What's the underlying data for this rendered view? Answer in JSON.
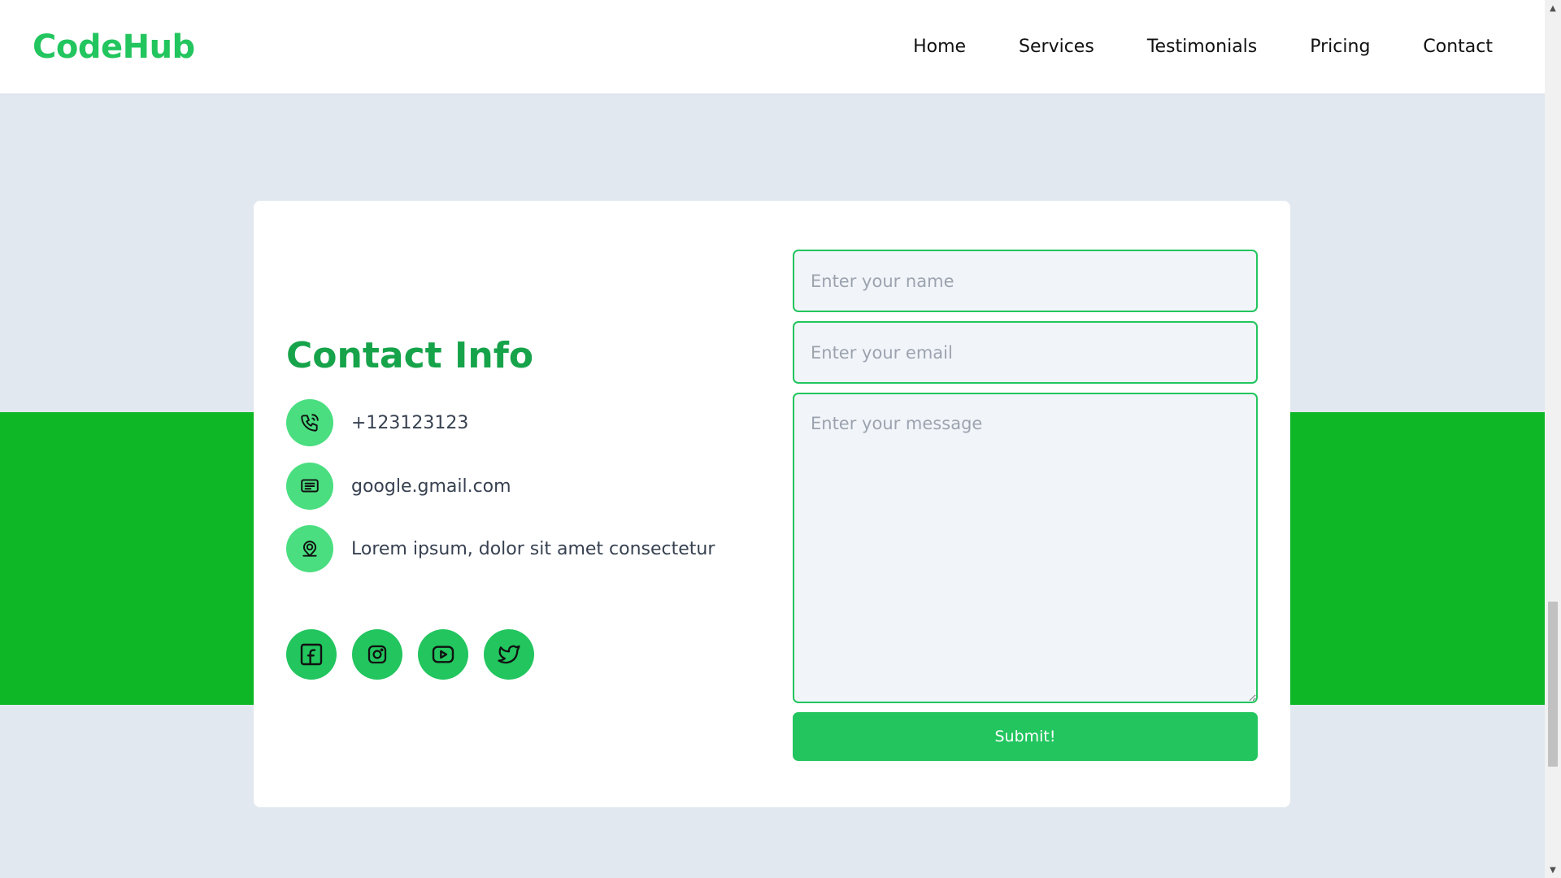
{
  "brand": {
    "name": "CodeHub",
    "color": "#22c55e"
  },
  "nav": {
    "items": [
      {
        "label": "Home"
      },
      {
        "label": "Services"
      },
      {
        "label": "Testimonials"
      },
      {
        "label": "Pricing"
      },
      {
        "label": "Contact"
      }
    ]
  },
  "contact": {
    "title": "Contact Info",
    "phone": {
      "icon": "phone-icon",
      "text": "+123123123"
    },
    "email": {
      "icon": "message-icon",
      "text": "google.gmail.com"
    },
    "address": {
      "icon": "location-pin-icon",
      "text": "Lorem ipsum, dolor sit amet consectetur"
    },
    "socials": [
      {
        "icon": "facebook-icon"
      },
      {
        "icon": "instagram-icon"
      },
      {
        "icon": "youtube-icon"
      },
      {
        "icon": "twitter-icon"
      }
    ]
  },
  "form": {
    "name_placeholder": "Enter your name",
    "email_placeholder": "Enter your email",
    "message_placeholder": "Enter your message",
    "submit_label": "Submit!"
  },
  "colors": {
    "accent": "#22c55e",
    "heading": "#16a34a",
    "band": "#0db725",
    "background": "#e2e8f0",
    "icon_bg": "#4ade80"
  }
}
